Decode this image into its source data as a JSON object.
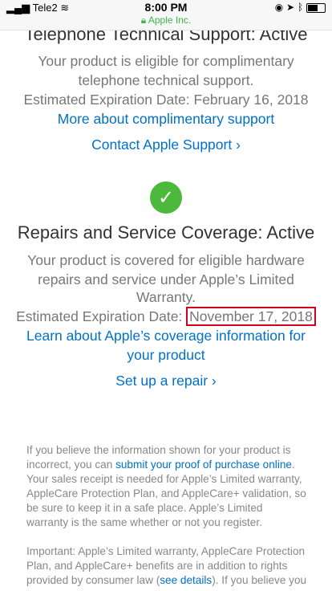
{
  "status_bar": {
    "carrier": "Tele2",
    "time": "8:00 PM",
    "site": "Apple Inc."
  },
  "telephone": {
    "title": "Telephone Technical Support: Active",
    "desc": [
      "Your product is eligible for complimentary",
      "telephone technical support."
    ],
    "expiration": "Estimated Expiration Date: February 16, 2018",
    "more_link": "More about complimentary support",
    "contact_link": "Contact Apple Support ›"
  },
  "repairs": {
    "title": "Repairs and Service Coverage: Active",
    "desc": [
      "Your product is covered for eligible hardware",
      "repairs and service under Apple’s Limited",
      "Warranty."
    ],
    "expiration_label": "Estimated Expiration Date: ",
    "expiration_date": "November 17, 2018",
    "learn_link": [
      "Learn about Apple’s coverage information for",
      "your product"
    ],
    "repair_link": "Set up a repair ›"
  },
  "footer": {
    "p1_before": "If you believe the information shown for your product is incorrect, you can ",
    "p1_link": "submit your proof of purchase online",
    "p1_after": ". Your sales receipt is needed for Apple’s Limited warranty, AppleCare Protection Plan, and AppleCare+ validation, so be sure to keep it in a safe place. Apple’s Limited warranty is the same whether or not you register.",
    "p2_before": "Important: Apple’s Limited warranty, AppleCare Protection Plan, and AppleCare+ benefits are in addition to rights provided by consumer law (",
    "p2_link": "see details",
    "p2_after": "). If you believe you"
  },
  "colors": {
    "link": "#0070c9",
    "check": "#4cb93c",
    "highlight": "#d0021b"
  }
}
